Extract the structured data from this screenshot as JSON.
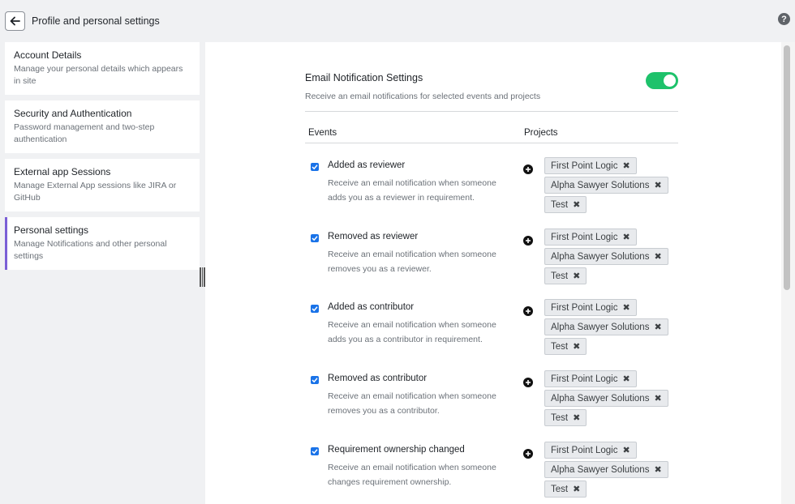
{
  "header": {
    "title": "Profile and personal settings"
  },
  "sidebar": {
    "items": [
      {
        "title": "Account Details",
        "desc": "Manage your personal details which appears in site"
      },
      {
        "title": "Security and Authentication",
        "desc": "Password management and two-step authentication"
      },
      {
        "title": "External app Sessions",
        "desc": "Manage External App sessions like JIRA or GitHub"
      },
      {
        "title": "Personal settings",
        "desc": "Manage Notifications and other personal settings"
      }
    ]
  },
  "settings": {
    "title": "Email Notification Settings",
    "desc": "Receive an email notifications for selected events and projects",
    "toggle_on": true,
    "toggle_color": "#1ec26b",
    "col_events": "Events",
    "col_projects": "Projects"
  },
  "events": [
    {
      "title": "Added as reviewer",
      "desc": "Receive an email notification when someone adds you as a reviewer in requirement.",
      "checked": true,
      "projects": [
        "First Point Logic",
        "Alpha Sawyer Solutions",
        "Test"
      ]
    },
    {
      "title": "Removed as reviewer",
      "desc": "Receive an email notification when someone removes you as a reviewer.",
      "checked": true,
      "projects": [
        "First Point Logic",
        "Alpha Sawyer Solutions",
        "Test"
      ]
    },
    {
      "title": "Added as contributor",
      "desc": "Receive an email notification when someone adds you as a contributor in requirement.",
      "checked": true,
      "projects": [
        "First Point Logic",
        "Alpha Sawyer Solutions",
        "Test"
      ]
    },
    {
      "title": "Removed as contributor",
      "desc": "Receive an email notification when someone removes you as a contributor.",
      "checked": true,
      "projects": [
        "First Point Logic",
        "Alpha Sawyer Solutions",
        "Test"
      ]
    },
    {
      "title": "Requirement ownership changed",
      "desc": "Receive an email notification when someone changes requirement ownership.",
      "checked": true,
      "projects": [
        "First Point Logic",
        "Alpha Sawyer Solutions",
        "Test"
      ]
    }
  ]
}
